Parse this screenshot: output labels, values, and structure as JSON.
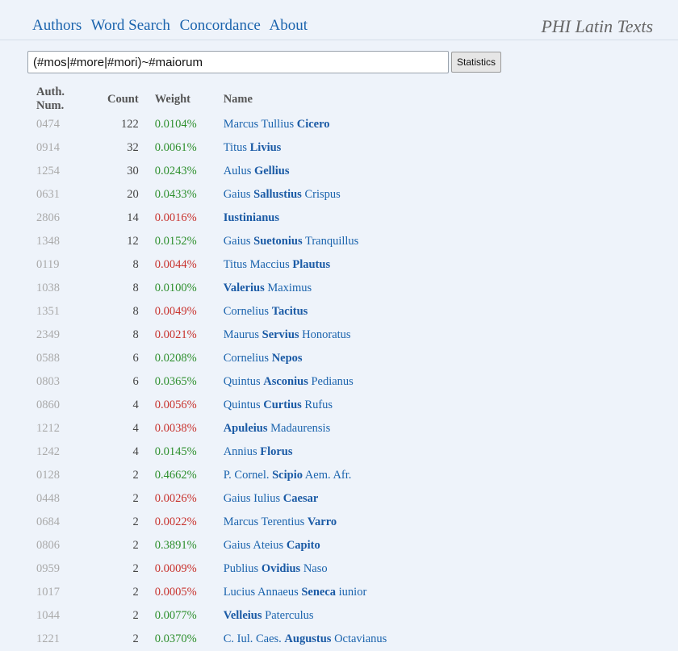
{
  "nav": {
    "items": [
      "Authors",
      "Word Search",
      "Concordance",
      "About"
    ],
    "brand": "PHI Latin Texts"
  },
  "search": {
    "value": "(#mos|#more|#mori)~#maiorum",
    "button_label": "Statistics"
  },
  "table": {
    "headers": {
      "num": "Auth. Num.",
      "count": "Count",
      "weight": "Weight",
      "name": "Name"
    },
    "colors": {
      "above": "#2d8f2d",
      "below": "#c8322d"
    },
    "rows": [
      {
        "num": "0474",
        "count": "122",
        "weight": "0.0104%",
        "trend": "up",
        "name": [
          [
            "Marcus Tullius ",
            false
          ],
          [
            "Cicero",
            true
          ]
        ]
      },
      {
        "num": "0914",
        "count": "32",
        "weight": "0.0061%",
        "trend": "up",
        "name": [
          [
            "Titus ",
            false
          ],
          [
            "Livius",
            true
          ]
        ]
      },
      {
        "num": "1254",
        "count": "30",
        "weight": "0.0243%",
        "trend": "up",
        "name": [
          [
            "Aulus ",
            false
          ],
          [
            "Gellius",
            true
          ]
        ]
      },
      {
        "num": "0631",
        "count": "20",
        "weight": "0.0433%",
        "trend": "up",
        "name": [
          [
            "Gaius ",
            false
          ],
          [
            "Sallustius",
            true
          ],
          [
            " Crispus",
            false
          ]
        ]
      },
      {
        "num": "2806",
        "count": "14",
        "weight": "0.0016%",
        "trend": "down",
        "name": [
          [
            "Iustinianus",
            true
          ]
        ]
      },
      {
        "num": "1348",
        "count": "12",
        "weight": "0.0152%",
        "trend": "up",
        "name": [
          [
            "Gaius ",
            false
          ],
          [
            "Suetonius",
            true
          ],
          [
            " Tranquillus",
            false
          ]
        ]
      },
      {
        "num": "0119",
        "count": "8",
        "weight": "0.0044%",
        "trend": "down",
        "name": [
          [
            "Titus Maccius ",
            false
          ],
          [
            "Plautus",
            true
          ]
        ]
      },
      {
        "num": "1038",
        "count": "8",
        "weight": "0.0100%",
        "trend": "up",
        "name": [
          [
            "Valerius",
            true
          ],
          [
            " Maximus",
            false
          ]
        ]
      },
      {
        "num": "1351",
        "count": "8",
        "weight": "0.0049%",
        "trend": "down",
        "name": [
          [
            "Cornelius ",
            false
          ],
          [
            "Tacitus",
            true
          ]
        ]
      },
      {
        "num": "2349",
        "count": "8",
        "weight": "0.0021%",
        "trend": "down",
        "name": [
          [
            "Maurus ",
            false
          ],
          [
            "Servius",
            true
          ],
          [
            " Honoratus",
            false
          ]
        ]
      },
      {
        "num": "0588",
        "count": "6",
        "weight": "0.0208%",
        "trend": "up",
        "name": [
          [
            "Cornelius ",
            false
          ],
          [
            "Nepos",
            true
          ]
        ]
      },
      {
        "num": "0803",
        "count": "6",
        "weight": "0.0365%",
        "trend": "up",
        "name": [
          [
            "Quintus ",
            false
          ],
          [
            "Asconius",
            true
          ],
          [
            " Pedianus",
            false
          ]
        ]
      },
      {
        "num": "0860",
        "count": "4",
        "weight": "0.0056%",
        "trend": "down",
        "name": [
          [
            "Quintus ",
            false
          ],
          [
            "Curtius",
            true
          ],
          [
            " Rufus",
            false
          ]
        ]
      },
      {
        "num": "1212",
        "count": "4",
        "weight": "0.0038%",
        "trend": "down",
        "name": [
          [
            "Apuleius",
            true
          ],
          [
            " Madaurensis",
            false
          ]
        ]
      },
      {
        "num": "1242",
        "count": "4",
        "weight": "0.0145%",
        "trend": "up",
        "name": [
          [
            "Annius ",
            false
          ],
          [
            "Florus",
            true
          ]
        ]
      },
      {
        "num": "0128",
        "count": "2",
        "weight": "0.4662%",
        "trend": "up",
        "name": [
          [
            "P. Cornel. ",
            false
          ],
          [
            "Scipio",
            true
          ],
          [
            " Aem. Afr.",
            false
          ]
        ]
      },
      {
        "num": "0448",
        "count": "2",
        "weight": "0.0026%",
        "trend": "down",
        "name": [
          [
            "Gaius Iulius ",
            false
          ],
          [
            "Caesar",
            true
          ]
        ]
      },
      {
        "num": "0684",
        "count": "2",
        "weight": "0.0022%",
        "trend": "down",
        "name": [
          [
            "Marcus Terentius ",
            false
          ],
          [
            "Varro",
            true
          ]
        ]
      },
      {
        "num": "0806",
        "count": "2",
        "weight": "0.3891%",
        "trend": "up",
        "name": [
          [
            "Gaius Ateius ",
            false
          ],
          [
            "Capito",
            true
          ]
        ]
      },
      {
        "num": "0959",
        "count": "2",
        "weight": "0.0009%",
        "trend": "down",
        "name": [
          [
            "Publius ",
            false
          ],
          [
            "Ovidius",
            true
          ],
          [
            " Naso",
            false
          ]
        ]
      },
      {
        "num": "1017",
        "count": "2",
        "weight": "0.0005%",
        "trend": "down",
        "name": [
          [
            "Lucius Annaeus ",
            false
          ],
          [
            "Seneca",
            true
          ],
          [
            " iunior",
            false
          ]
        ]
      },
      {
        "num": "1044",
        "count": "2",
        "weight": "0.0077%",
        "trend": "up",
        "name": [
          [
            "Velleius",
            true
          ],
          [
            " Paterculus",
            false
          ]
        ]
      },
      {
        "num": "1221",
        "count": "2",
        "weight": "0.0370%",
        "trend": "up",
        "name": [
          [
            "C. Iul. Caes. ",
            false
          ],
          [
            "Augustus",
            true
          ],
          [
            " Octavianus",
            false
          ]
        ]
      }
    ]
  }
}
